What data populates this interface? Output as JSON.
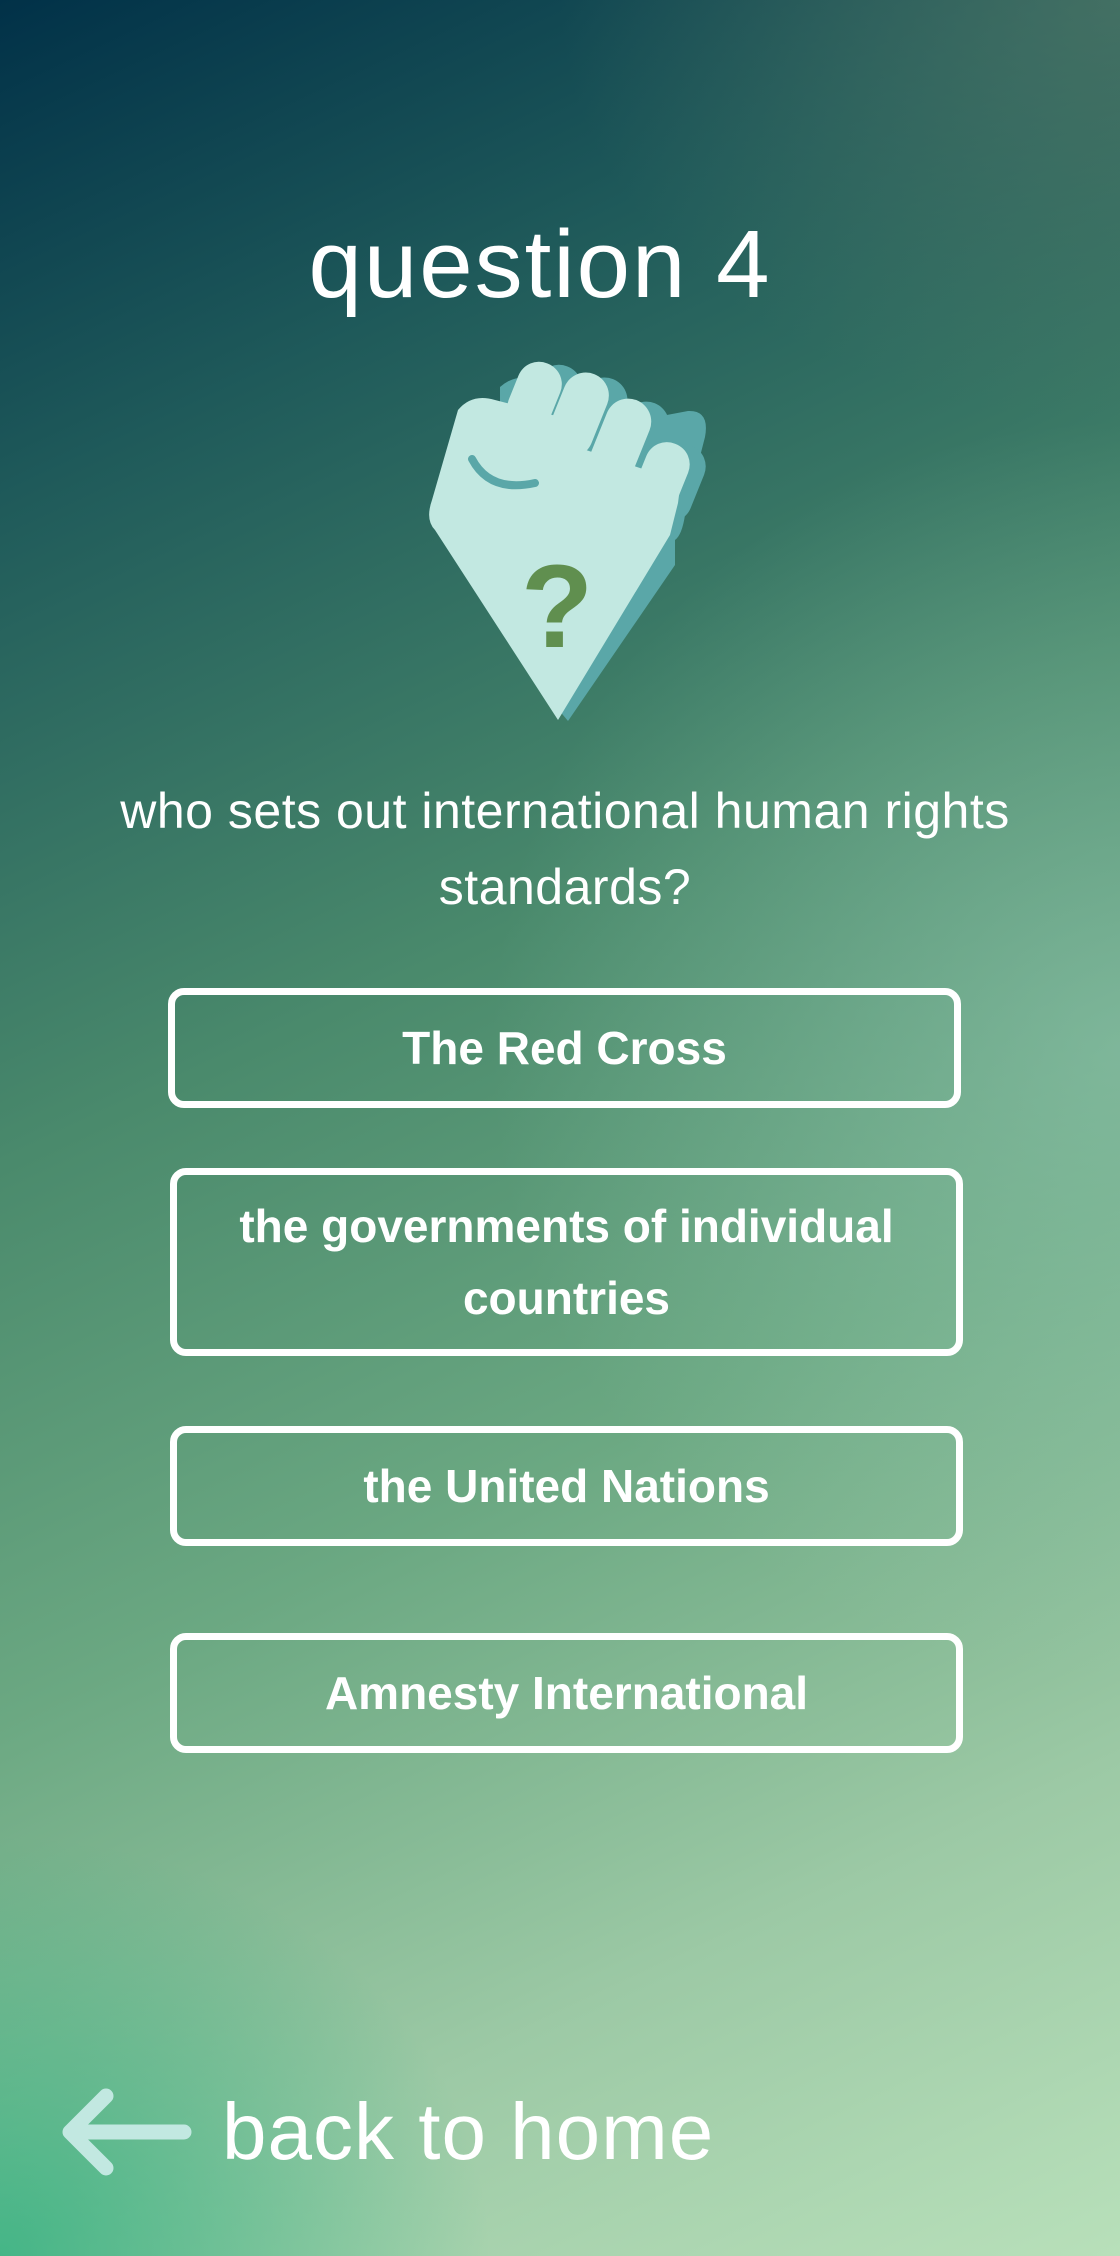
{
  "page": {
    "title": "question 4",
    "question": "who sets out international human rights standards?"
  },
  "icon": {
    "name": "raised-fist-question-icon",
    "mark": "?",
    "colors": {
      "fist": "#c2e8e1",
      "shadow": "#5aa7a8",
      "mark": "#608f4f"
    }
  },
  "answers": [
    {
      "label": "The Red Cross"
    },
    {
      "label": "the governments of individual countries"
    },
    {
      "label": "the United Nations"
    },
    {
      "label": "Amnesty International"
    }
  ],
  "nav": {
    "back_label": "back to home",
    "back_icon": "arrow-left-icon",
    "arrow_color": "#c2e8e1"
  }
}
